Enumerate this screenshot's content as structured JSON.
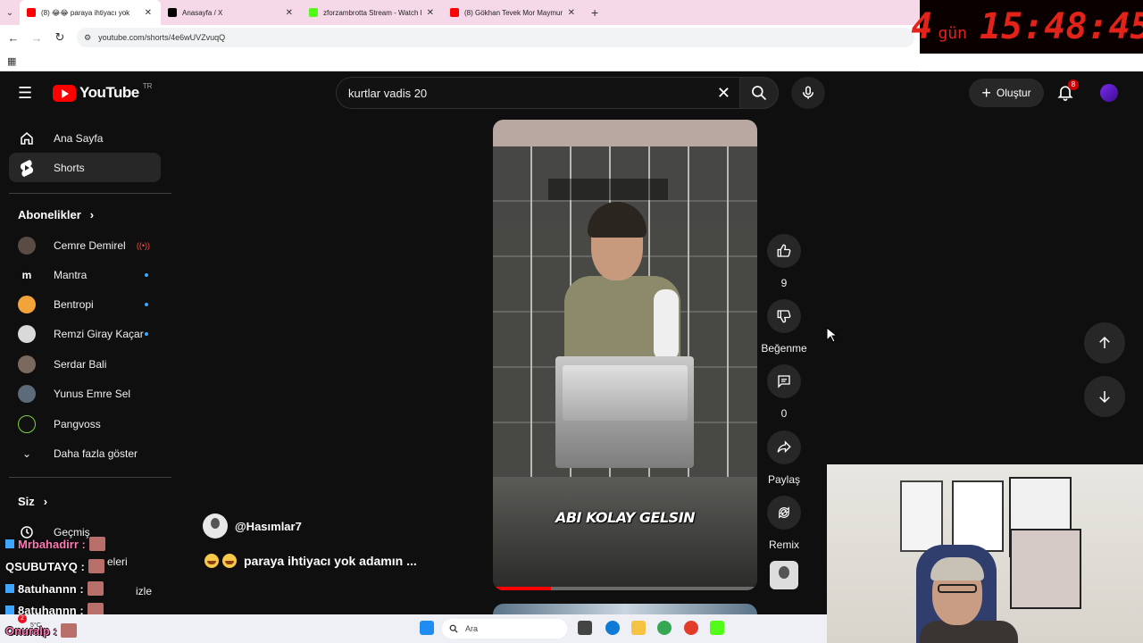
{
  "browser": {
    "tabs": [
      {
        "title": "(8) 😂😂 paraya ihtiyacı yok",
        "color": "#ff0000",
        "active": true
      },
      {
        "title": "Anasayfa / X",
        "color": "#000000",
        "active": false
      },
      {
        "title": "zforzambrotta Stream - Watch l",
        "color": "#53fc18",
        "active": false
      },
      {
        "title": "(8) Gökhan Tevek Mor Maymun",
        "color": "#ff0000",
        "active": false
      }
    ],
    "url": "youtube.com/shorts/4e6wUVZvuqQ"
  },
  "countdown": {
    "days": "4",
    "unit": "gün",
    "time": "15:48:45"
  },
  "header": {
    "logo_text": "YouTube",
    "country": "TR",
    "search_value": "kurtlar vadis  20",
    "create_label": "Oluştur",
    "notif_count": "8"
  },
  "sidebar": {
    "home": "Ana Sayfa",
    "shorts": "Shorts",
    "subscriptions_heading": "Abonelikler",
    "channels": [
      {
        "name": "Cemre Demirel",
        "color": "#5a4b44",
        "status": "live"
      },
      {
        "name": "Mantra",
        "color": "#0f0f0f",
        "status": "new"
      },
      {
        "name": "Bentropi",
        "color": "#f2a43a",
        "status": "new"
      },
      {
        "name": "Remzi Giray Kaçar",
        "color": "#d9d9d9",
        "status": "new"
      },
      {
        "name": "Serdar Bali",
        "color": "#7a6a5d",
        "status": ""
      },
      {
        "name": "Yunus Emre Sel",
        "color": "#5d6a7a",
        "status": ""
      },
      {
        "name": "Pangvoss",
        "color": "#111111",
        "status": ""
      }
    ],
    "show_more": "Daha fazla göster",
    "you_heading": "Siz",
    "history": "Geçmiş",
    "playlists_partial": "eleri",
    "watch_later_partial": "izle"
  },
  "short": {
    "channel": "@Hasımlar7",
    "title": "paraya ihtiyacı yok adamın ...",
    "caption": "ABI KOLAY GELSIN",
    "progress": 0.22
  },
  "actions": {
    "likes": "9",
    "dislike_label": "Beğenme",
    "comments": "0",
    "share_label": "Paylaş",
    "remix_label": "Remix"
  },
  "chat": [
    {
      "user": "Mrbahadirr :",
      "color": "pink"
    },
    {
      "user": "QSUBUTAYQ :",
      "color": "white"
    },
    {
      "user": "8atuhannn :",
      "color": "white"
    },
    {
      "user": "8atuhannn :",
      "color": "white"
    },
    {
      "user": "Onuralp :",
      "color": "pink"
    }
  ],
  "taskbar": {
    "search_placeholder": "Ara",
    "weather": "5°C",
    "weather_badge": "2"
  }
}
